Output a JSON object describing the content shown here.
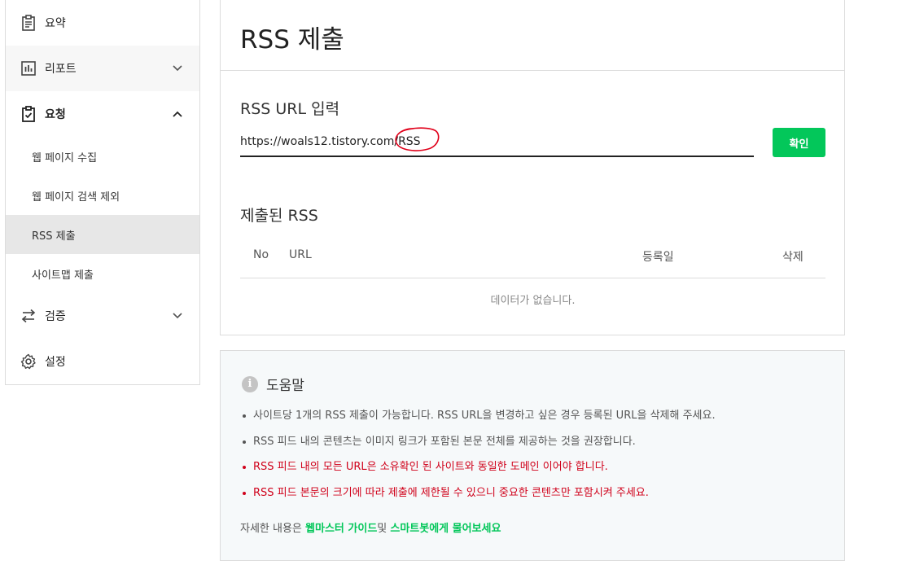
{
  "sidebar": {
    "items": [
      {
        "label": "요약",
        "icon": "clipboard-icon"
      },
      {
        "label": "리포트",
        "icon": "bar-chart-icon"
      },
      {
        "label": "요청",
        "icon": "clipboard-check-icon"
      },
      {
        "label": "검증",
        "icon": "swap-arrows-icon"
      },
      {
        "label": "설정",
        "icon": "gear-icon"
      }
    ],
    "sub_items": [
      "웹 페이지 수집",
      "웹 페이지 검색 제외",
      "RSS 제출",
      "사이트맵 제출"
    ],
    "active_sub_item": "RSS 제출"
  },
  "main": {
    "title": "RSS 제출",
    "input_label": "RSS URL 입력",
    "input_value": "https://woals12.tistory.com/RSS",
    "confirm_label": "확인",
    "submitted_label": "제출된 RSS",
    "table": {
      "columns": [
        "No",
        "URL",
        "등록일",
        "삭제"
      ],
      "empty_message": "데이터가 없습니다."
    }
  },
  "help": {
    "title": "도움말",
    "items": [
      {
        "text": "사이트당 1개의 RSS 제출이 가능합니다. RSS URL을 변경하고 싶은 경우 등록된 URL을 삭제해 주세요.",
        "highlight": false
      },
      {
        "text": "RSS 피드 내의 콘텐츠는 이미지 링크가 포함된 본문 전체를 제공하는 것을 권장합니다.",
        "highlight": false
      },
      {
        "text": "RSS 피드 내의 모든 URL은 소유확인 된 사이트와 동일한 도메인 이어야 합니다.",
        "highlight": true
      },
      {
        "text": "RSS 피드 본문의 크기에 따라 제출에 제한될 수 있으니 중요한 콘텐츠만 포함시켜 주세요.",
        "highlight": true
      }
    ],
    "footer_prefix": "자세한 내용은 ",
    "guide_link": "웹마스터 가이드",
    "footer_middle": "및 ",
    "bot_link": "스마트봇에게 물어보세요"
  },
  "colors": {
    "accent": "#03c75a",
    "warning": "#d0021b",
    "annotation": "#e0001a"
  }
}
